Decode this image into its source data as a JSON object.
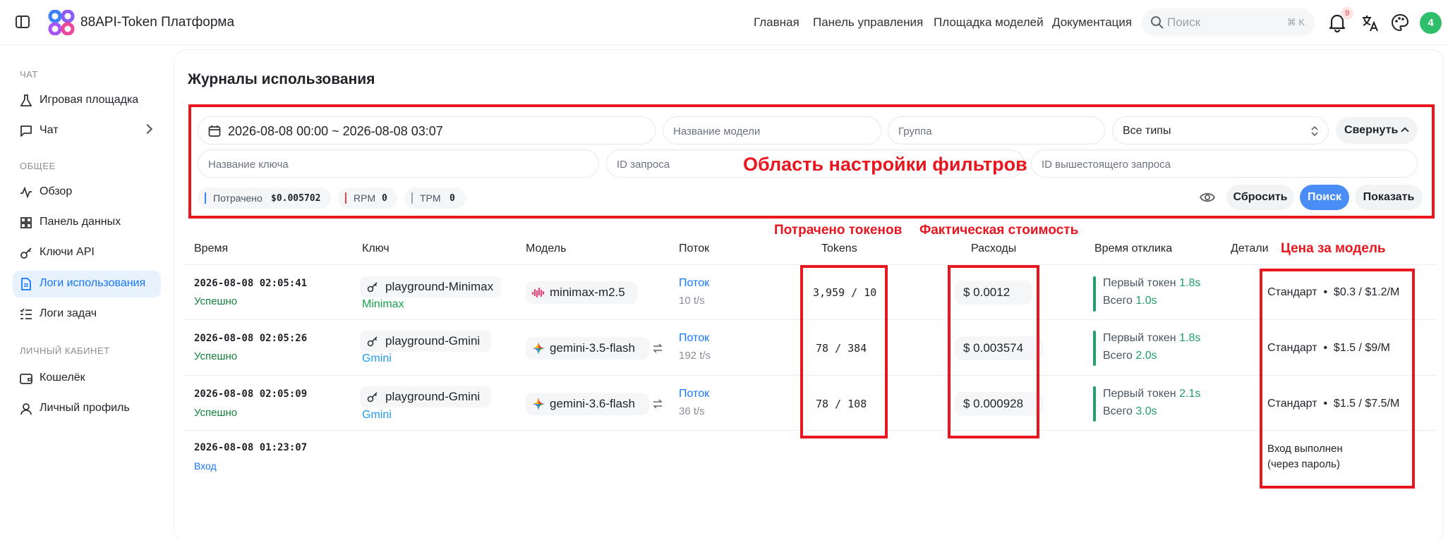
{
  "app": {
    "brand": "88API-Token Платформа"
  },
  "nav": {
    "home": "Главная",
    "dashboard": "Панель управления",
    "models": "Площадка моделей",
    "docs": "Документация"
  },
  "search": {
    "placeholder": "Поиск",
    "shortcut": "⌘ K"
  },
  "notifications": {
    "count": "9"
  },
  "user": {
    "avatar": "4"
  },
  "sidebar": {
    "sec_chat": "ЧАТ",
    "playground": "Игровая площадка",
    "chat": "Чат",
    "sec_general": "ОБЩЕЕ",
    "overview": "Обзор",
    "data_panel": "Панель данных",
    "api_keys": "Ключи API",
    "usage_logs": "Логи использования",
    "task_logs": "Логи задач",
    "sec_account": "ЛИЧНЫЙ КАБИНЕТ",
    "wallet": "Кошелёк",
    "profile": "Личный профиль"
  },
  "page": {
    "title": "Журналы использования"
  },
  "filters": {
    "date_range": "2026-08-08 00:00 ~ 2026-08-08 03:07",
    "model_placeholder": "Название модели",
    "group_placeholder": "Группа",
    "type_value": "Все типы",
    "collapse": "Свернуть",
    "key_placeholder": "Название ключа",
    "request_id_placeholder": "ID запроса",
    "upstream_id_placeholder": "ID вышестоящего запроса",
    "reset": "Сбросить",
    "search": "Поиск",
    "show": "Показать"
  },
  "stats": {
    "spent_label": "Потрачено",
    "spent_value": "$0.005702",
    "rpm_label": "RPM",
    "rpm_value": "0",
    "tpm_label": "TPM",
    "tpm_value": "0"
  },
  "annotations": {
    "filter_area": "Область настройки фильтров",
    "tokens_spent": "Потрачено токенов",
    "actual_cost": "Фактическая стоимость",
    "model_price": "Цена за модель"
  },
  "table": {
    "headers": {
      "time": "Время",
      "key": "Ключ",
      "model": "Модель",
      "stream": "Поток",
      "tokens": "Tokens",
      "cost": "Расходы",
      "response": "Время отклика",
      "details": "Детали"
    },
    "rows": [
      {
        "time": "2026-08-08 02:05:41",
        "status": "Успешно",
        "key": "playground-Minimax",
        "group": "Minimax",
        "group_color": "#15a34a",
        "model": "minimax-m2.5",
        "stream": "Поток",
        "tps": "10 t/s",
        "tokens": "3,959 / 10",
        "cost": "$ 0.0012",
        "first_label": "Первый токен",
        "first_value": "1.8s",
        "total_label": "Всего",
        "total_value": "1.0s",
        "price": "Стандарт  •  $0.3 / $1.2/M"
      },
      {
        "time": "2026-08-08 02:05:26",
        "status": "Успешно",
        "key": "playground-Gmini",
        "group": "Gmini",
        "group_color": "#1d9bf0",
        "model": "gemini-3.5-flash",
        "stream": "Поток",
        "tps": "192 t/s",
        "tokens": "78 / 384",
        "cost": "$ 0.003574",
        "first_label": "Первый токен",
        "first_value": "1.8s",
        "total_label": "Всего",
        "total_value": "2.0s",
        "price": "Стандарт  •  $1.5 / $9/M"
      },
      {
        "time": "2026-08-08 02:05:09",
        "status": "Успешно",
        "key": "playground-Gmini",
        "group": "Gmini",
        "group_color": "#1d9bf0",
        "model": "gemini-3.6-flash",
        "stream": "Поток",
        "tps": "36 t/s",
        "tokens": "78 / 108",
        "cost": "$ 0.000928",
        "first_label": "Первый токен",
        "first_value": "2.1s",
        "total_label": "Всего",
        "total_value": "3.0s",
        "price": "Стандарт  •  $1.5 / $7.5/M"
      },
      {
        "time": "2026-08-08 01:23:07",
        "status": "Вход",
        "note_line1": "Вход выполнен",
        "note_line2": "(через пароль)"
      }
    ]
  }
}
